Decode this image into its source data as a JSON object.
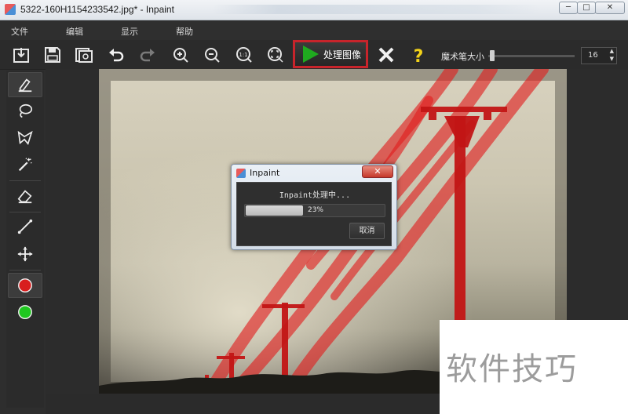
{
  "window": {
    "title": "5322-160H1154233542.jpg* - Inpaint",
    "minimize_glyph": "─",
    "maximize_glyph": "□",
    "close_glyph": "✕"
  },
  "menu": [
    "文件",
    "编辑",
    "显示",
    "帮助"
  ],
  "toolbar": {
    "tools": [
      "open-icon",
      "save-icon",
      "save-as-icon",
      "undo-icon",
      "redo-icon",
      "zoom-in-icon",
      "zoom-out-icon",
      "zoom-actual-icon",
      "zoom-fit-icon"
    ],
    "process_label": "处理图像",
    "cancel_icon": "close-x-icon",
    "help_icon": "question-icon",
    "brush_size_label": "魔术笔大小",
    "brush_size_value": "16"
  },
  "palette": [
    "marker-icon",
    "lasso-icon",
    "polygon-lasso-icon",
    "magic-wand-icon",
    "eraser-icon",
    "line-icon",
    "move-icon",
    "red-color-icon",
    "green-color-icon"
  ],
  "colors": {
    "mask_red": "#d81e1e",
    "accent_red": "#c8242b",
    "green": "#1fc71f",
    "play_green": "#1faa1f"
  },
  "dialog": {
    "title": "Inpaint",
    "message": "Inpaint处理中...",
    "progress_text": "23%",
    "progress": 0.23,
    "cancel_label": "取消",
    "close_glyph": "✕"
  },
  "watermark": {
    "text": "软件技巧"
  }
}
